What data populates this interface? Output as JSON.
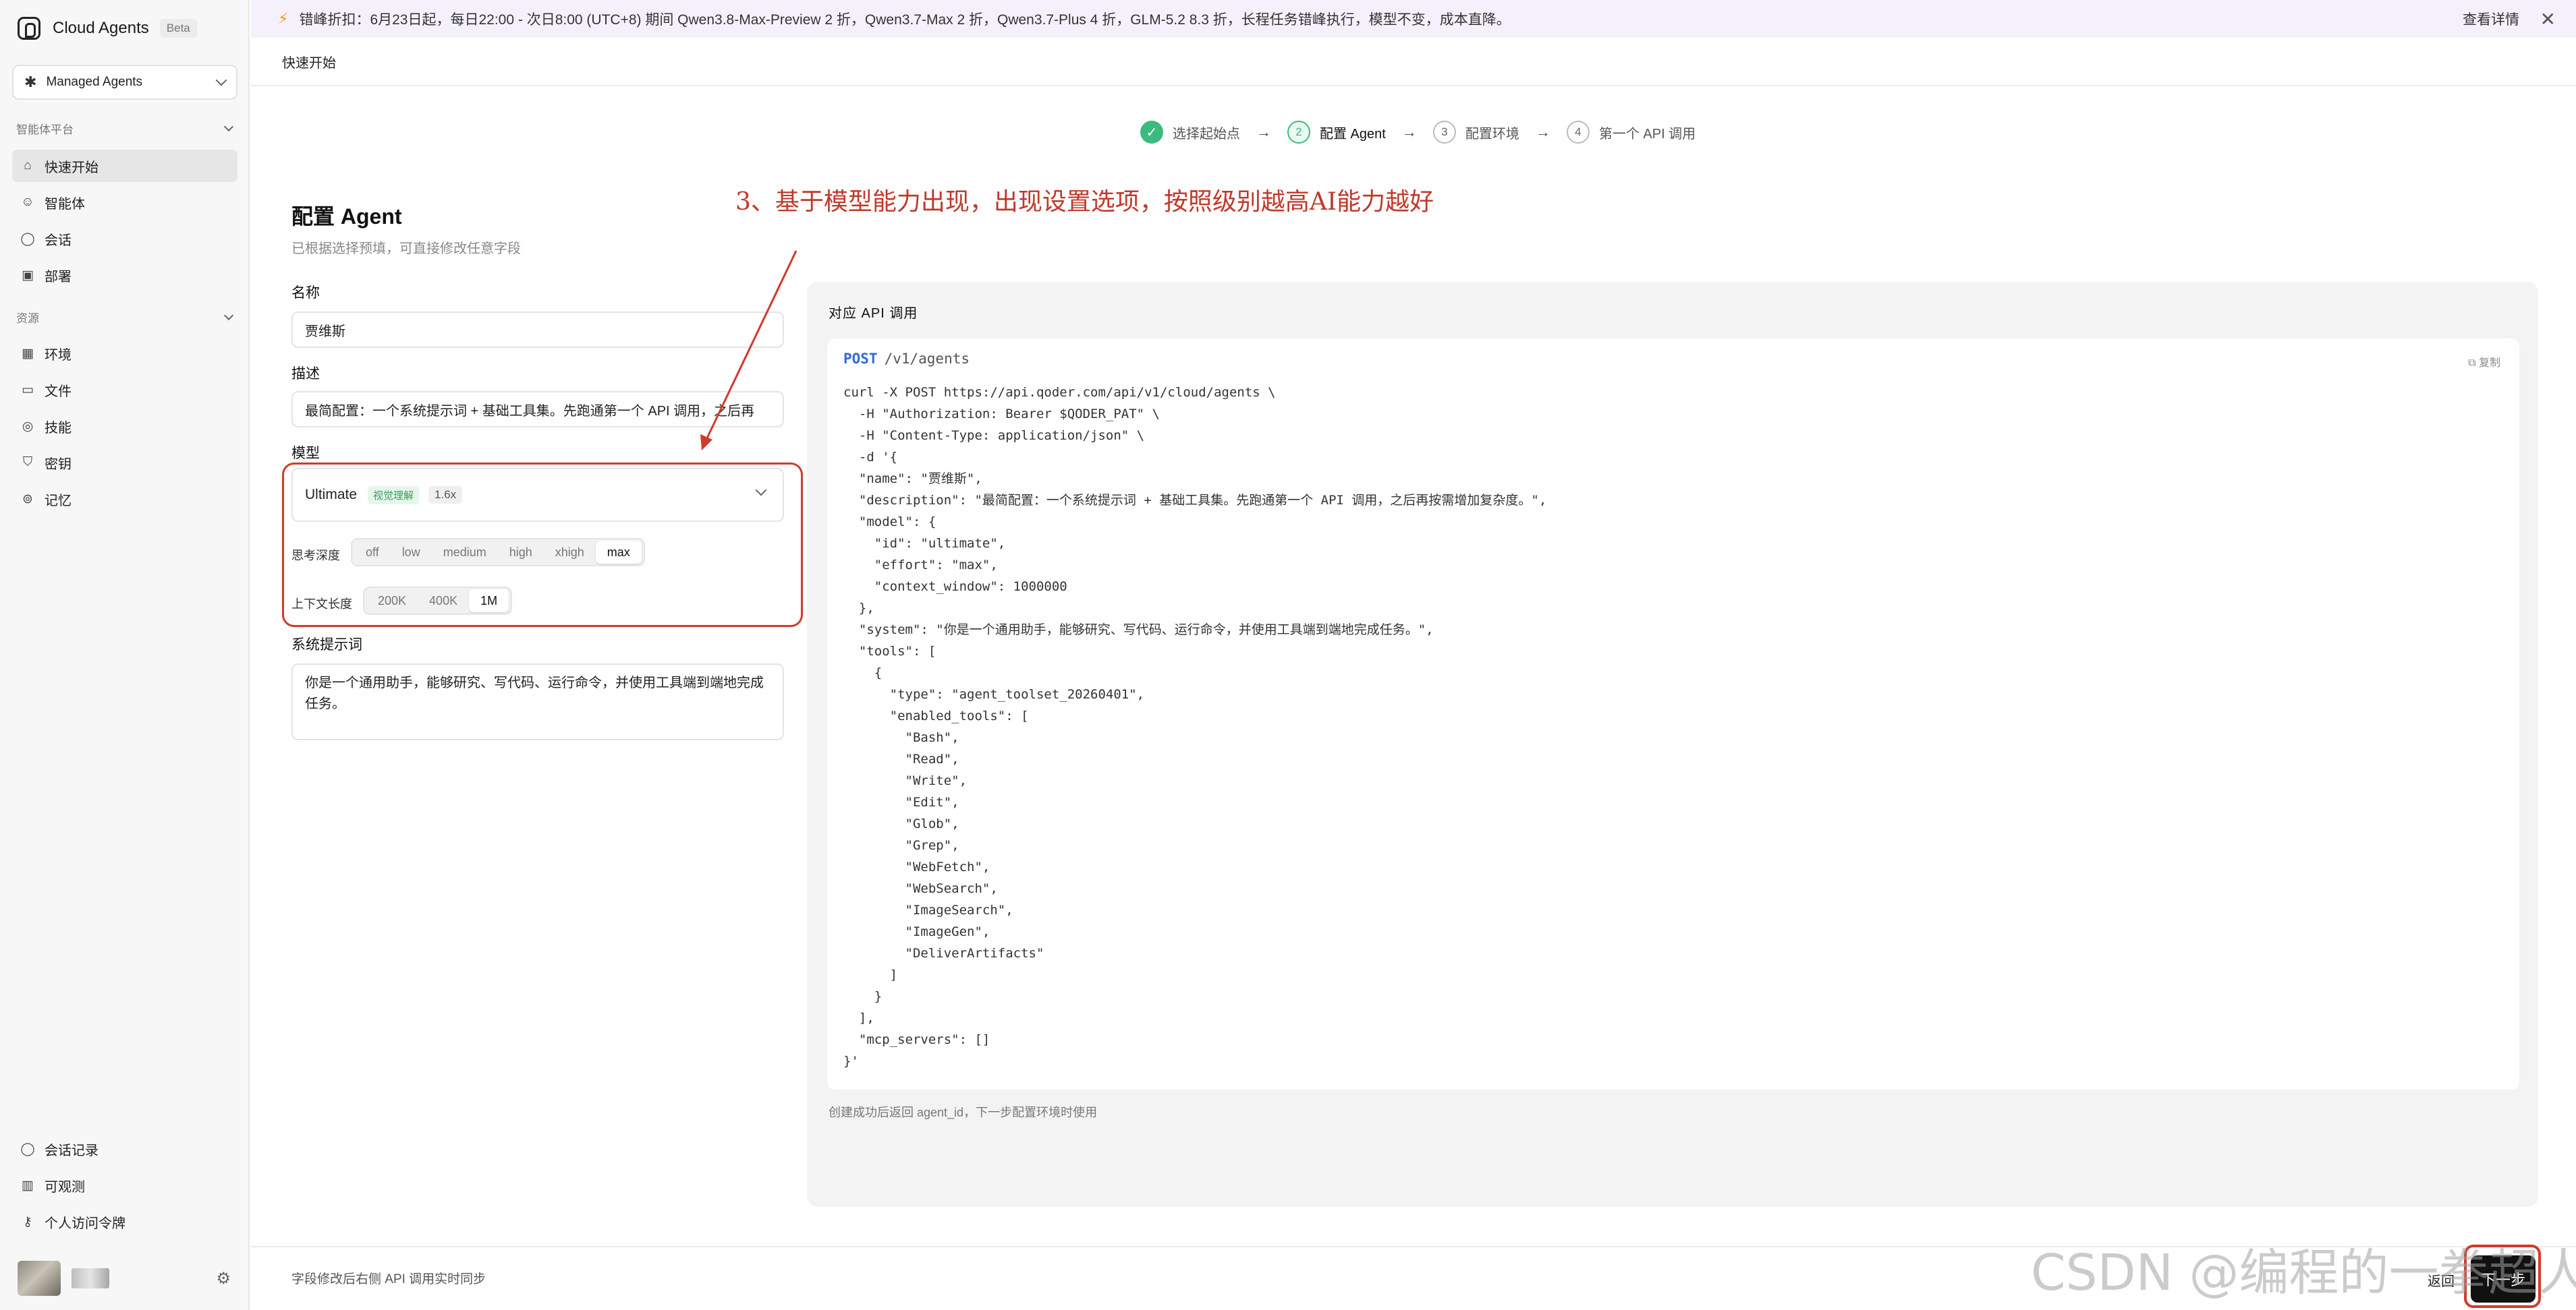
{
  "sidebar": {
    "brand": {
      "name": "Cloud Agents",
      "badge": "Beta"
    },
    "workspace": "Managed Agents",
    "groups": [
      {
        "title": "智能体平台",
        "items": [
          {
            "label": "快速开始",
            "icon": "home-icon",
            "active": true
          },
          {
            "label": "智能体",
            "icon": "agent-icon"
          },
          {
            "label": "会话",
            "icon": "chat-icon"
          },
          {
            "label": "部署",
            "icon": "deploy-icon"
          }
        ]
      },
      {
        "title": "资源",
        "items": [
          {
            "label": "环境",
            "icon": "grid-icon"
          },
          {
            "label": "文件",
            "icon": "folder-icon"
          },
          {
            "label": "技能",
            "icon": "bulb-icon"
          },
          {
            "label": "密钥",
            "icon": "shield-icon"
          },
          {
            "label": "记忆",
            "icon": "memory-icon"
          }
        ]
      }
    ],
    "bottom_items": [
      {
        "label": "会话记录",
        "icon": "chat-history-icon"
      },
      {
        "label": "可观测",
        "icon": "chart-icon"
      },
      {
        "label": "个人访问令牌",
        "icon": "key-icon"
      }
    ]
  },
  "banner": {
    "text": "错峰折扣：6月23日起，每日22:00 - 次日8:00 (UTC+8) 期间 Qwen3.8-Max-Preview 2 折，Qwen3.7-Max 2 折，Qwen3.7-Plus 4 折，GLM-5.2 8.3 折，长程任务错峰执行，模型不变，成本直降。",
    "link": "查看详情",
    "close": "✕"
  },
  "breadcrumb": "快速开始",
  "stepper": [
    {
      "num": "✓",
      "label": "选择起始点",
      "state": "done"
    },
    {
      "num": "2",
      "label": "配置 Agent",
      "state": "current"
    },
    {
      "num": "3",
      "label": "配置环境",
      "state": "todo"
    },
    {
      "num": "4",
      "label": "第一个 API 调用",
      "state": "todo"
    }
  ],
  "form": {
    "title": "配置 Agent",
    "subtitle": "已根据选择预填，可直接修改任意字段",
    "name_label": "名称",
    "name_value": "贾维斯",
    "desc_label": "描述",
    "desc_value": "最简配置：一个系统提示词 + 基础工具集。先跑通第一个 API 调用，之后再",
    "model_label": "模型",
    "model": {
      "name": "Ultimate",
      "tag": "视觉理解",
      "multiplier": "1.6x"
    },
    "effort_label": "思考深度",
    "effort_options": [
      "off",
      "low",
      "medium",
      "high",
      "xhigh",
      "max"
    ],
    "effort_selected": "max",
    "context_label": "上下文长度",
    "context_options": [
      "200K",
      "400K",
      "1M"
    ],
    "context_selected": "1M",
    "prompt_label": "系统提示词",
    "prompt_value": "你是一个通用助手，能够研究、写代码、运行命令，并使用工具端到端地完成任务。"
  },
  "annotation": {
    "text": "3、基于模型能力出现，出现设置选项，按照级别越高AI能力越好",
    "color": "#d23a2a"
  },
  "api": {
    "title": "对应 API 调用",
    "method": "POST",
    "path": "/v1/agents",
    "copy": "复制",
    "code": "curl -X POST https://api.qoder.com/api/v1/cloud/agents \\\n  -H \"Authorization: Bearer $QODER_PAT\" \\\n  -H \"Content-Type: application/json\" \\\n  -d '{\n  \"name\": \"贾维斯\",\n  \"description\": \"最简配置：一个系统提示词 + 基础工具集。先跑通第一个 API 调用，之后再按需增加复杂度。\",\n  \"model\": {\n    \"id\": \"ultimate\",\n    \"effort\": \"max\",\n    \"context_window\": 1000000\n  },\n  \"system\": \"你是一个通用助手，能够研究、写代码、运行命令，并使用工具端到端地完成任务。\",\n  \"tools\": [\n    {\n      \"type\": \"agent_toolset_20260401\",\n      \"enabled_tools\": [\n        \"Bash\",\n        \"Read\",\n        \"Write\",\n        \"Edit\",\n        \"Glob\",\n        \"Grep\",\n        \"WebFetch\",\n        \"WebSearch\",\n        \"ImageSearch\",\n        \"ImageGen\",\n        \"DeliverArtifacts\"\n      ]\n    }\n  ],\n  \"mcp_servers\": []\n}'",
    "footer": "创建成功后返回 agent_id，下一步配置环境时使用"
  },
  "bottom": {
    "sync_note": "字段修改后右侧 API 调用实时同步",
    "back": "返回",
    "next": "下一步"
  },
  "watermark": "CSDN @编程的一拳超人"
}
